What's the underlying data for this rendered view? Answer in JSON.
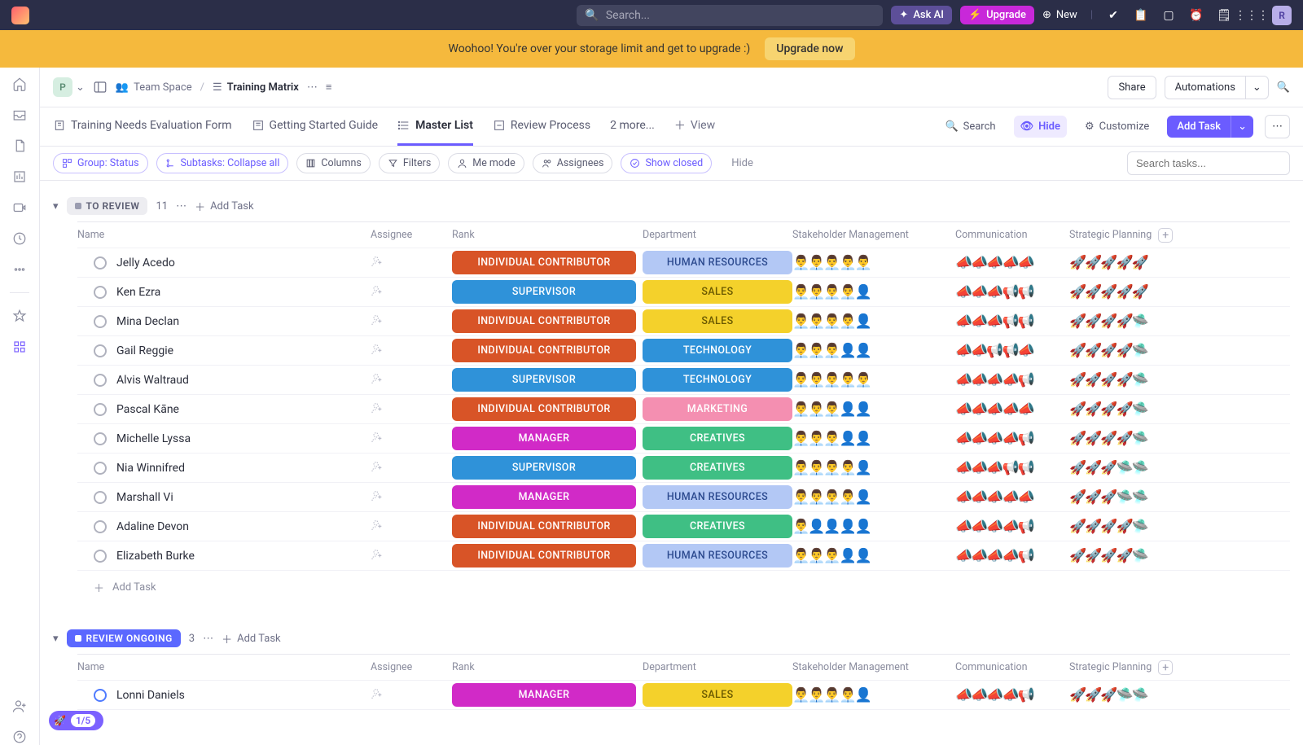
{
  "top": {
    "search_placeholder": "Search...",
    "ask_ai": "Ask AI",
    "upgrade": "Upgrade",
    "new": "New",
    "avatar_initial": "R"
  },
  "banner": {
    "text": "Woohoo! You're over your storage limit and get to upgrade :)",
    "button": "Upgrade now"
  },
  "crumbs": {
    "workspace_initial": "P",
    "space": "Team Space",
    "list": "Training Matrix",
    "share": "Share",
    "automations": "Automations"
  },
  "views": {
    "tabs": [
      {
        "label": "Training Needs Evaluation Form"
      },
      {
        "label": "Getting Started Guide"
      },
      {
        "label": "Master List",
        "active": true
      },
      {
        "label": "Review Process"
      },
      {
        "label": "2 more..."
      }
    ],
    "add_view": "View",
    "search": "Search",
    "hide": "Hide",
    "customize": "Customize",
    "add_task": "Add Task"
  },
  "filters": {
    "group": "Group: Status",
    "subtasks": "Subtasks: Collapse all",
    "columns": "Columns",
    "filters": "Filters",
    "me": "Me mode",
    "assignees": "Assignees",
    "show_closed": "Show closed",
    "hide": "Hide",
    "search_placeholder": "Search tasks..."
  },
  "columns": {
    "name": "Name",
    "assignee": "Assignee",
    "rank": "Rank",
    "department": "Department",
    "stakeholder": "Stakeholder Management",
    "communication": "Communication",
    "strategic": "Strategic Planning"
  },
  "groups": [
    {
      "key": "to_review",
      "label": "TO REVIEW",
      "chip_class": "review",
      "count": "11",
      "add_task": "Add Task",
      "rows": [
        {
          "name": "Jelly Acedo",
          "rank": "INDIVIDUAL CONTRIBUTOR",
          "rank_c": "b-ic",
          "dept": "HUMAN RESOURCES",
          "dept_c": "d-hr",
          "stake": "👨‍💼👨‍💼👨‍💼👨‍💼👨‍💼",
          "comm": "📣📣📣📣📣",
          "strat": "🚀🚀🚀🚀🚀"
        },
        {
          "name": "Ken Ezra",
          "rank": "SUPERVISOR",
          "rank_c": "b-sup",
          "dept": "SALES",
          "dept_c": "d-sales",
          "stake": "👨‍💼👨‍💼👨‍💼👨‍💼👤",
          "comm": "📣📣📣📢📢",
          "strat": "🚀🚀🚀🚀🚀"
        },
        {
          "name": "Mina Declan",
          "rank": "INDIVIDUAL CONTRIBUTOR",
          "rank_c": "b-ic",
          "dept": "SALES",
          "dept_c": "d-sales",
          "stake": "👨‍💼👨‍💼👨‍💼👨‍💼👤",
          "comm": "📣📣📣📢📢",
          "strat": "🚀🚀🚀🚀🛸"
        },
        {
          "name": "Gail Reggie",
          "rank": "INDIVIDUAL CONTRIBUTOR",
          "rank_c": "b-ic",
          "dept": "TECHNOLOGY",
          "dept_c": "d-tech",
          "stake": "👨‍💼👨‍💼👨‍💼👤👤",
          "comm": "📣📣📢📢📣",
          "strat": "🚀🚀🚀🚀🛸"
        },
        {
          "name": "Alvis Waltraud",
          "rank": "SUPERVISOR",
          "rank_c": "b-sup",
          "dept": "TECHNOLOGY",
          "dept_c": "d-tech",
          "stake": "👨‍💼👨‍💼👨‍💼👨‍💼👨‍💼",
          "comm": "📣📣📣📣📢",
          "strat": "🚀🚀🚀🚀🛸"
        },
        {
          "name": "Pascal Kāne",
          "rank": "INDIVIDUAL CONTRIBUTOR",
          "rank_c": "b-ic",
          "dept": "MARKETING",
          "dept_c": "d-mkt",
          "stake": "👨‍💼👨‍💼👨‍💼👤👤",
          "comm": "📣📣📣📣📣",
          "strat": "🚀🚀🚀🚀🛸"
        },
        {
          "name": "Michelle Lyssa",
          "rank": "MANAGER",
          "rank_c": "b-mgr",
          "dept": "CREATIVES",
          "dept_c": "d-creat",
          "stake": "👨‍💼👨‍💼👨‍💼👤👤",
          "comm": "📣📣📣📣📢",
          "strat": "🚀🚀🚀🚀🛸"
        },
        {
          "name": "Nia Winnifred",
          "rank": "SUPERVISOR",
          "rank_c": "b-sup",
          "dept": "CREATIVES",
          "dept_c": "d-creat",
          "stake": "👨‍💼👨‍💼👨‍💼👨‍💼👤",
          "comm": "📣📣📣📢📢",
          "strat": "🚀🚀🚀🛸🛸"
        },
        {
          "name": "Marshall Vi",
          "rank": "MANAGER",
          "rank_c": "b-mgr",
          "dept": "HUMAN RESOURCES",
          "dept_c": "d-hr",
          "stake": "👨‍💼👨‍💼👨‍💼👨‍💼👤",
          "comm": "📣📣📣📣📣",
          "strat": "🚀🚀🚀🛸🛸"
        },
        {
          "name": "Adaline Devon",
          "rank": "INDIVIDUAL CONTRIBUTOR",
          "rank_c": "b-ic",
          "dept": "CREATIVES",
          "dept_c": "d-creat",
          "stake": "👨‍💼👤👤👤👤",
          "comm": "📣📣📣📣📢",
          "strat": "🚀🚀🚀🚀🛸"
        },
        {
          "name": "Elizabeth Burke",
          "rank": "INDIVIDUAL CONTRIBUTOR",
          "rank_c": "b-ic",
          "dept": "HUMAN RESOURCES",
          "dept_c": "d-hr",
          "stake": "👨‍💼👨‍💼👨‍💼👤👤",
          "comm": "📣📣📣📣📢",
          "strat": "🚀🚀🚀🚀🛸"
        }
      ],
      "footer_add": "Add Task"
    },
    {
      "key": "review_ongoing",
      "label": "REVIEW ONGOING",
      "chip_class": "ongoing",
      "count": "3",
      "add_task": "Add Task",
      "rows": [
        {
          "name": "Lonni Daniels",
          "rank": "MANAGER",
          "rank_c": "b-mgr",
          "dept": "SALES",
          "dept_c": "d-sales",
          "stake": "👨‍💼👨‍💼👨‍💼👨‍💼👤",
          "comm": "📣📣📣📣📢",
          "strat": "🚀🚀🚀🛸🛸"
        }
      ]
    }
  ],
  "float_badge": "1/5"
}
